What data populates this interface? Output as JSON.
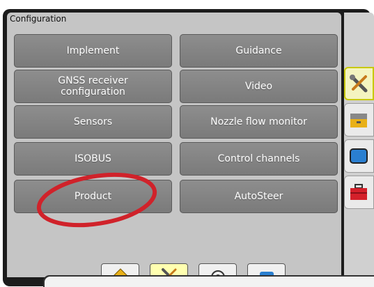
{
  "panel": {
    "title": "Configuration"
  },
  "buttons": [
    {
      "id": "implement",
      "label": "Implement"
    },
    {
      "id": "guidance",
      "label": "Guidance"
    },
    {
      "id": "gnss-receiver-configuration",
      "label": "GNSS receiver configuration"
    },
    {
      "id": "video",
      "label": "Video"
    },
    {
      "id": "sensors",
      "label": "Sensors"
    },
    {
      "id": "nozzle-flow-monitor",
      "label": "Nozzle flow monitor"
    },
    {
      "id": "isobus",
      "label": "ISOBUS"
    },
    {
      "id": "control-channels",
      "label": "Control channels"
    },
    {
      "id": "product",
      "label": "Product"
    },
    {
      "id": "autosteer",
      "label": "AutoSteer"
    }
  ],
  "side_tabs": [
    {
      "icon": "wrench-screwdriver-icon",
      "active": true
    },
    {
      "icon": "toolbox-icon",
      "active": false
    },
    {
      "icon": "display-icon",
      "active": false
    },
    {
      "icon": "red-toolbox-icon",
      "active": false
    }
  ],
  "bottom_tabs": [
    {
      "icon": "home-icon",
      "active": false
    },
    {
      "icon": "tools-icon",
      "active": true
    },
    {
      "icon": "target-icon",
      "active": false
    },
    {
      "icon": "screen-icon",
      "active": false
    }
  ],
  "annotation": {
    "shape": "ellipse",
    "color": "#d0222a",
    "target": "product"
  }
}
